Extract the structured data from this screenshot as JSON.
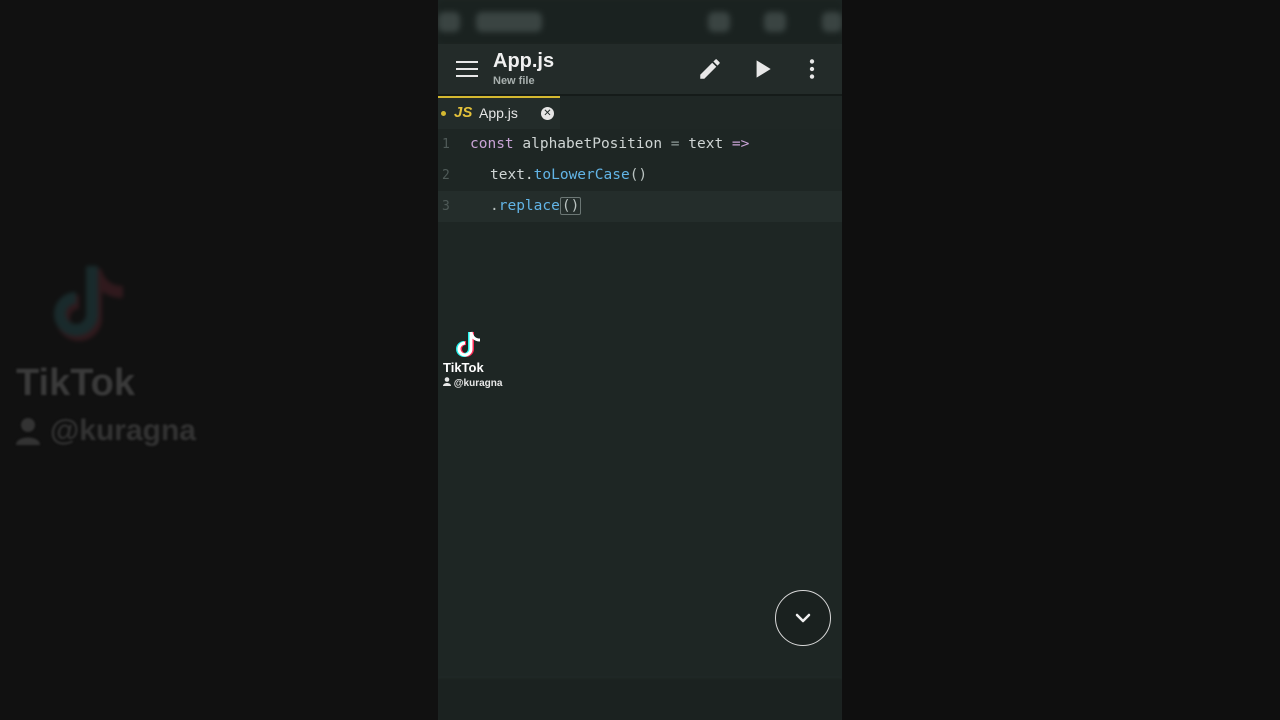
{
  "background": {
    "brand": "TikTok",
    "username": "@kuragna"
  },
  "appbar": {
    "title": "App.js",
    "subtitle": "New file",
    "menu_icon": "hamburger-menu-icon",
    "edit_icon": "pencil-icon",
    "run_icon": "play-icon",
    "more_icon": "more-vertical-icon"
  },
  "tabs": [
    {
      "badge": "JS",
      "label": "App.js",
      "modified": true,
      "close_icon": "close-circle-icon"
    }
  ],
  "editor": {
    "lines": [
      {
        "number": "1",
        "tokens": [
          "const",
          " alphabetPosition ",
          "=",
          " text ",
          "=>"
        ]
      },
      {
        "number": "2",
        "tokens": [
          "text.",
          "toLowerCase",
          "()"
        ]
      },
      {
        "number": "3",
        "tokens": [
          ".",
          "replace",
          "(",
          ")"
        ]
      }
    ]
  },
  "watermark": {
    "brand": "TikTok",
    "username": "@kuragna"
  },
  "fab": {
    "icon": "chevron-down-icon"
  },
  "colors": {
    "accent": "#d4b830",
    "editor_bg": "#1e2624",
    "keyword": "#c9a3d6",
    "function": "#62b4e6"
  }
}
